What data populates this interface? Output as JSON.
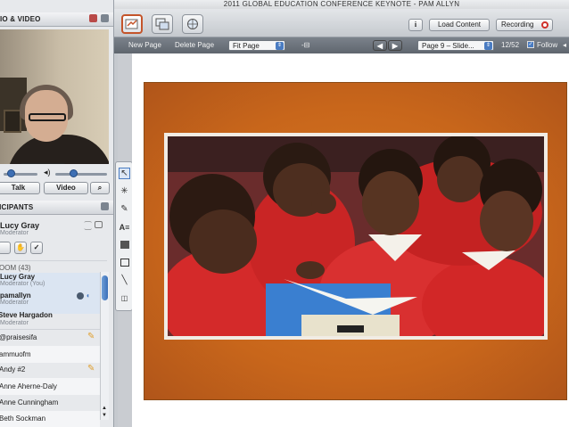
{
  "app": {
    "title": "2011 GLOBAL EDUCATION CONFERENCE KEYNOTE - PAM ALLYN"
  },
  "colors": {
    "accent_blue": "#3e6fb4",
    "toolbar_dark": "#5f666e",
    "slide_bg": "#c8661b",
    "record_red": "#d0302a"
  },
  "audio_video": {
    "header": "DIO & VIDEO",
    "presenter_name": "pamallyn",
    "talk_label": "Talk",
    "video_label": "Video"
  },
  "participants": {
    "header": "TICIPANTS",
    "current_user": {
      "name": "Lucy Gray",
      "role": "Moderator"
    },
    "room_label": "OOM (43)",
    "list": [
      {
        "name": "Lucy Gray",
        "role": "Moderator (You)"
      },
      {
        "name": "pamallyn",
        "role": "Moderator"
      },
      {
        "name": "Steve Hargadon",
        "role": "Moderator"
      },
      {
        "name": "@praisesifa"
      },
      {
        "name": "ammuofm"
      },
      {
        "name": "Andy #2"
      },
      {
        "name": "Anne Aherne-Daly"
      },
      {
        "name": "Anne Cunningham"
      },
      {
        "name": "Beth Sockman"
      }
    ]
  },
  "toolbar": {
    "load_content": "Load Content",
    "recording": "Recording",
    "info_label": "i"
  },
  "subbar": {
    "new_page": "New Page",
    "delete_page": "Delete Page",
    "zoom_value": "Fit Page",
    "page_select": "Page 9 – Slide...",
    "page_count": "12/52",
    "follow_label": "Follow"
  },
  "icons": {
    "whiteboard": "whiteboard-icon",
    "app_share": "app-share-icon",
    "web_tour": "web-tour-icon",
    "select_tool": "arrow-pointer-icon",
    "pen_tool": "pencil-icon"
  }
}
